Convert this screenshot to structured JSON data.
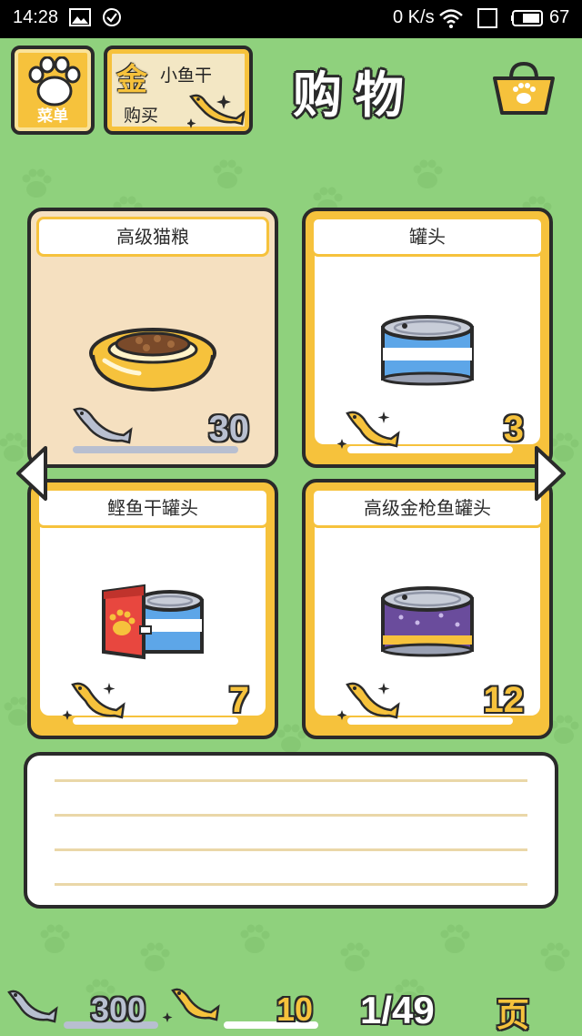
{
  "status_bar": {
    "time": "14:28",
    "net_speed": "0 K/s",
    "battery": "67"
  },
  "header": {
    "menu_label": "菜单",
    "gold_char": "金",
    "gold_line1": "小鱼干",
    "gold_line2": "购买",
    "title": "购物"
  },
  "items": [
    {
      "name": "高级猫粮",
      "price": "30",
      "currency": "silver-fish",
      "selected": true
    },
    {
      "name": "罐头",
      "price": "3",
      "currency": "gold-fish",
      "selected": false
    },
    {
      "name": "鲣鱼干罐头",
      "price": "7",
      "currency": "gold-fish",
      "selected": false
    },
    {
      "name": "高级金枪鱼罐头",
      "price": "12",
      "currency": "gold-fish",
      "selected": false
    }
  ],
  "footer": {
    "silver_count": "300",
    "gold_count": "10",
    "page": "1/49",
    "page_label": "页"
  },
  "colors": {
    "background": "#8fd17d",
    "accent_yellow": "#f6c23c",
    "outline": "#2a2a2a",
    "selected_card": "#f5e0c0"
  }
}
